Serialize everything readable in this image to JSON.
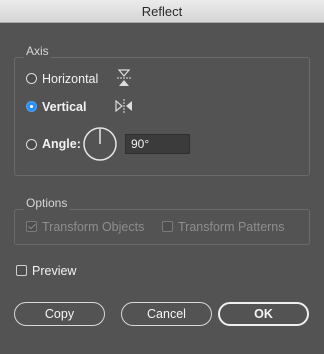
{
  "window": {
    "title": "Reflect"
  },
  "axis": {
    "legend": "Axis",
    "horizontal_label": "Horizontal",
    "vertical_label": "Vertical",
    "angle_label": "Angle:",
    "angle_value": "90°",
    "selected": "vertical",
    "icons": [
      "reflect-horizontal-icon",
      "reflect-vertical-icon",
      "angle-dial-icon"
    ]
  },
  "options": {
    "legend": "Options",
    "transform_objects_label": "Transform Objects",
    "transform_objects_checked": true,
    "transform_patterns_label": "Transform Patterns",
    "transform_patterns_checked": false
  },
  "preview": {
    "label": "Preview",
    "checked": false
  },
  "buttons": {
    "copy": "Copy",
    "cancel": "Cancel",
    "ok": "OK"
  },
  "colors": {
    "background": "#535353",
    "radio_selected": "#2f8ff0",
    "titlebar": "#e0e0e0"
  }
}
